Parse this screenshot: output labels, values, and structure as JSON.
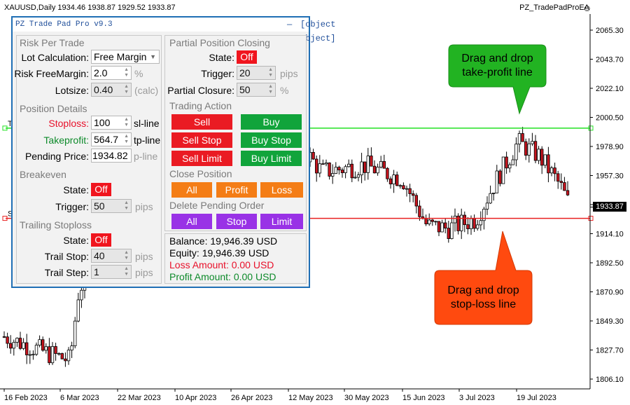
{
  "header": {
    "symbol_info": "XAUUSD,Daily  1934.46 1938.87 1929.52 1933.87",
    "ea_name": "PZ_TradePadProEA",
    "smile_icon": "☺"
  },
  "chart": {
    "price_axis": [
      "2065.30",
      "2043.70",
      "2022.10",
      "2000.50",
      "1978.90",
      "1957.30",
      "1935.70",
      "1914.10",
      "1892.50",
      "1870.90",
      "1849.30",
      "1827.70",
      "1806.10"
    ],
    "date_axis": [
      "16 Feb 2023",
      "6 Mar 2023",
      "22 Mar 2023",
      "10 Apr 2023",
      "26 Apr 2023",
      "12 May 2023",
      "30 May 2023",
      "15 Jun 2023",
      "3 Jul 2023",
      "19 Jul 2023"
    ],
    "current_price": "1933.87",
    "tp_price": 1992.5,
    "sl_price": 1925.5,
    "line_label_tp": "T",
    "line_label_sl": "S",
    "colors": {
      "bull": "#ffffff",
      "bear": "#c8141e",
      "tp_line": "#22e022",
      "sl_line": "#e82020"
    }
  },
  "callouts": {
    "tp": "Drag and drop take-profit line",
    "sl": "Drag and drop stop-loss line",
    "tp_color": "#22b322",
    "sl_color": "#ff4a0f"
  },
  "pad": {
    "title": "PZ Trade Pad Pro v9.3",
    "minimize": "—",
    "close": {
      "section": "Close Position",
      "all": "All",
      "profit": "Profit",
      "loss": "Loss"
    },
    "risk": {
      "section": "Risk Per Trade",
      "lot_calc_label": "Lot Calculation:",
      "lot_calc_value": "Free Margin",
      "risk_label": "Risk FreeMargin:",
      "risk_value": "2.0",
      "risk_unit": "%",
      "lotsize_label": "Lotsize:",
      "lotsize_value": "0.40",
      "lotsize_unit": "(calc)"
    },
    "position": {
      "section": "Position Details",
      "sl_label": "Stoploss:",
      "sl_value": "100",
      "sl_unit": "sl-line",
      "tp_label": "Takeprofit:",
      "tp_value": "564.7",
      "tp_unit": "tp-line",
      "pending_label": "Pending Price:",
      "pending_value": "1934.82",
      "pending_unit": "p-line"
    },
    "breakeven": {
      "section": "Breakeven",
      "state_label": "State:",
      "state_value": "Off",
      "trigger_label": "Trigger:",
      "trigger_value": "50",
      "trigger_unit": "pips"
    },
    "trailing": {
      "section": "Trailing Stoploss",
      "state_label": "State:",
      "state_value": "Off",
      "stop_label": "Trail Stop:",
      "stop_value": "40",
      "stop_unit": "pips",
      "step_label": "Trail Step:",
      "step_value": "1",
      "step_unit": "pips"
    },
    "partial": {
      "section": "Partial Position Closing",
      "state_label": "State:",
      "state_value": "Off",
      "trigger_label": "Trigger:",
      "trigger_value": "20",
      "trigger_unit": "pips",
      "closure_label": "Partial Closure:",
      "closure_value": "50",
      "closure_unit": "%"
    },
    "trading": {
      "section": "Trading Action",
      "sell": "Sell",
      "buy": "Buy",
      "sell_stop": "Sell Stop",
      "buy_stop": "Buy Stop",
      "sell_limit": "Sell Limit",
      "buy_limit": "Buy Limit"
    },
    "delete": {
      "section": "Delete Pending Order",
      "all": "All",
      "stop": "Stop",
      "limit": "Limit"
    },
    "account": {
      "balance": "Balance: 19,946.39 USD",
      "equity": "Equity: 19,946.39 USD",
      "loss": "Loss Amount: 0.00 USD",
      "profit": "Profit Amount: 0.00 USD"
    }
  }
}
